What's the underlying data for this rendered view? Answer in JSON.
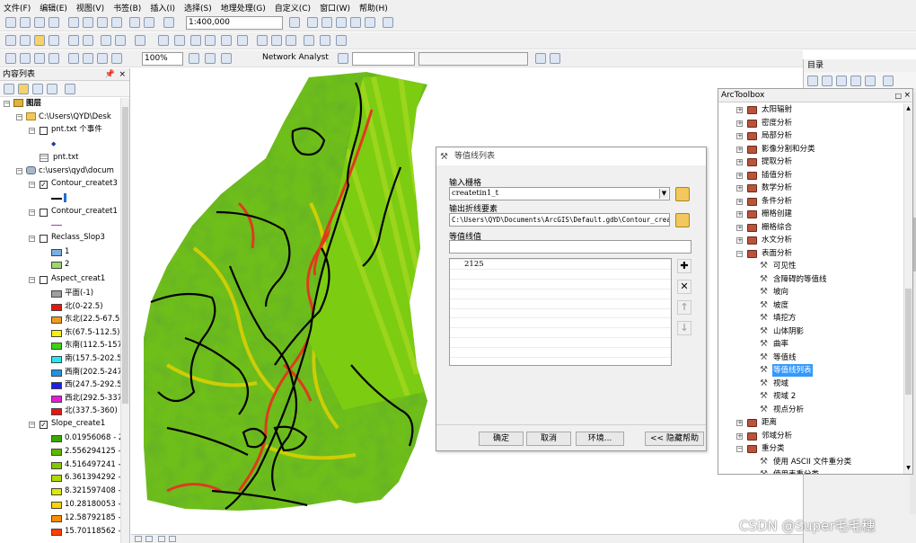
{
  "menubar": {
    "items": [
      "文件(F)",
      "编辑(E)",
      "视图(V)",
      "书签(B)",
      "插入(I)",
      "选择(S)",
      "地理处理(G)",
      "自定义(C)",
      "窗口(W)",
      "帮助(H)"
    ]
  },
  "toolbar": {
    "scale": "1:400,000",
    "zoom": "100%",
    "network_analyst": "Network Analyst"
  },
  "toc": {
    "title": "内容列表",
    "layers_label": "图层",
    "folder1": "C:\\Users\\QYD\\Desk",
    "pnt_event": "pnt.txt 个事件",
    "pnt_table": "pnt.txt",
    "folder2": "c:\\users\\qyd\\docum",
    "contour3": "Contour_createt3",
    "contour1": "Contour_createt1",
    "reclass": "Reclass_Slop3",
    "reclass_items": [
      "1",
      "2"
    ],
    "aspect": "Aspect_creat1",
    "aspect_items": [
      {
        "label": "平面(-1)",
        "color": "#9e9e9e"
      },
      {
        "label": "北(0-22.5)",
        "color": "#e8140f"
      },
      {
        "label": "东北(22.5-67.5)",
        "color": "#f29a1d"
      },
      {
        "label": "东(67.5-112.5)",
        "color": "#f8f10a"
      },
      {
        "label": "东南(112.5-157",
        "color": "#3cd217"
      },
      {
        "label": "南(157.5-202.5",
        "color": "#21e9f2"
      },
      {
        "label": "西南(202.5-247",
        "color": "#1e94e2"
      },
      {
        "label": "西(247.5-292.5",
        "color": "#1f1fe8"
      },
      {
        "label": "西北(292.5-337",
        "color": "#e81ad8"
      },
      {
        "label": "北(337.5-360)",
        "color": "#e8140f"
      }
    ],
    "slope": "Slope_create1",
    "slope_items": [
      {
        "label": "0.01956068 - 2",
        "color": "#38a800"
      },
      {
        "label": "2.556294125 -",
        "color": "#5bb800"
      },
      {
        "label": "4.516497241 -",
        "color": "#85c900"
      },
      {
        "label": "6.361394292 -",
        "color": "#b0d900"
      },
      {
        "label": "8.321597408 -",
        "color": "#e0e800"
      },
      {
        "label": "10.28180053 -",
        "color": "#ffd400"
      },
      {
        "label": "12.58792185 -",
        "color": "#ff8c00"
      },
      {
        "label": "15.70118562 -",
        "color": "#ff3c00"
      }
    ]
  },
  "dialog": {
    "title": "等值线列表",
    "input_raster_label": "输入栅格",
    "input_raster_value": "createtin1_t",
    "output_label": "输出折线要素",
    "output_value": "C:\\Users\\QYD\\Documents\\ArcGIS\\Default.gdb\\Contour_createt",
    "values_label": "等值线值",
    "values": [
      "2125"
    ],
    "buttons": {
      "ok": "确定",
      "cancel": "取消",
      "env": "环境...",
      "hide_help": "<< 隐藏帮助"
    }
  },
  "catalog": {
    "title": "目录"
  },
  "arctoolbox": {
    "title": "ArcToolbox",
    "toolsets": [
      "太阳辐射",
      "密度分析",
      "局部分析",
      "影像分割和分类",
      "提取分析",
      "插值分析",
      "数学分析",
      "条件分析",
      "栅格创建",
      "栅格综合",
      "水文分析",
      "表面分析"
    ],
    "surface_tools": [
      "可见性",
      "含障碍的等值线",
      "坡向",
      "坡度",
      "填挖方",
      "山体阴影",
      "曲率",
      "等值线",
      "等值线列表",
      "视域",
      "视域 2",
      "视点分析"
    ],
    "after": [
      "距离",
      "邻域分析",
      "重分类"
    ],
    "reclass_tools": [
      "使用 ASCII 文件重分类",
      "使用表重分类"
    ],
    "selected": "等值线列表"
  },
  "watermark": "CSDN @Super毛毛穗",
  "colors": {
    "selection": "#3399ff",
    "map_green": "#4caf18",
    "map_red": "#d9301e"
  }
}
